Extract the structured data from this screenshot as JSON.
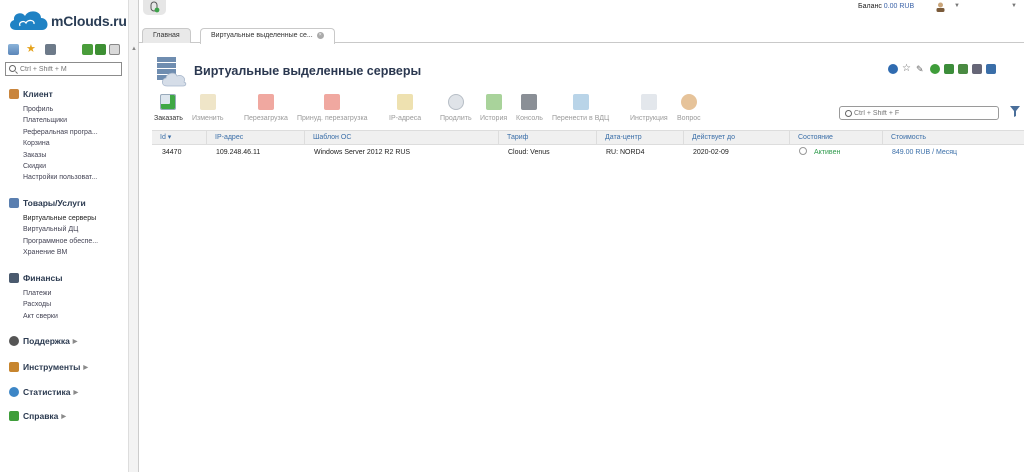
{
  "logo": {
    "text": "mClouds.ru"
  },
  "sidebar": {
    "search_placeholder": "Ctrl + Shift + M",
    "groups": [
      {
        "title": "Клиент",
        "icon": "client-icon",
        "items": [
          "Профиль",
          "Плательщики",
          "Реферальная програ...",
          "Корзина",
          "Заказы",
          "Скидки",
          "Настройки пользоват..."
        ]
      },
      {
        "title": "Товары/Услуги",
        "icon": "services-icon",
        "items": [
          "Виртуальные серверы",
          "Виртуальный ДЦ",
          "Программное обеспе...",
          "Хранение ВМ"
        ]
      },
      {
        "title": "Финансы",
        "icon": "finance-icon",
        "items": [
          "Платежи",
          "Расходы",
          "Акт сверки"
        ]
      },
      {
        "title": "Поддержка",
        "icon": "support-icon",
        "items": []
      },
      {
        "title": "Инструменты",
        "icon": "tools-icon",
        "items": []
      },
      {
        "title": "Статистика",
        "icon": "stats-icon",
        "items": []
      },
      {
        "title": "Справка",
        "icon": "help-icon",
        "items": []
      }
    ]
  },
  "header": {
    "balance_label": "Баланс",
    "balance_value": "0.00 RUB"
  },
  "tabs": [
    {
      "label": "Главная"
    },
    {
      "label": "Виртуальные выделенные се..."
    }
  ],
  "page": {
    "title": "Виртуальные выделенные серверы"
  },
  "toolbar": {
    "buttons": [
      {
        "label": "Заказать",
        "enabled": true
      },
      {
        "label": "Изменить",
        "enabled": false
      },
      {
        "label": "Перезагрузка",
        "enabled": false
      },
      {
        "label": "Принуд. перезагрузка",
        "enabled": false
      },
      {
        "label": "IP-адреса",
        "enabled": false
      },
      {
        "label": "Продлить",
        "enabled": false
      },
      {
        "label": "История",
        "enabled": false
      },
      {
        "label": "Консоль",
        "enabled": false
      },
      {
        "label": "Перенести в ВДЦ",
        "enabled": false
      },
      {
        "label": "Инструкция",
        "enabled": false
      },
      {
        "label": "Вопрос",
        "enabled": false
      }
    ],
    "search_placeholder": "Ctrl + Shift + F"
  },
  "table": {
    "columns": [
      "Id",
      "IP-адрес",
      "Шаблон ОС",
      "Тариф",
      "Дата-центр",
      "Действует до",
      "Состояние",
      "Стоимость"
    ],
    "rows": [
      {
        "id": "34470",
        "ip": "109.248.46.11",
        "os": "Windows Server 2012 R2 RUS",
        "tariff": "Cloud: Venus",
        "dc": "RU: NORD4",
        "until": "2020-02-09",
        "status": "Активен",
        "cost": "849.00 RUB / Месяц"
      }
    ]
  },
  "colors": {
    "accent": "#3a6ea8",
    "status_active": "#2e9a4c",
    "title": "#2b3850"
  }
}
